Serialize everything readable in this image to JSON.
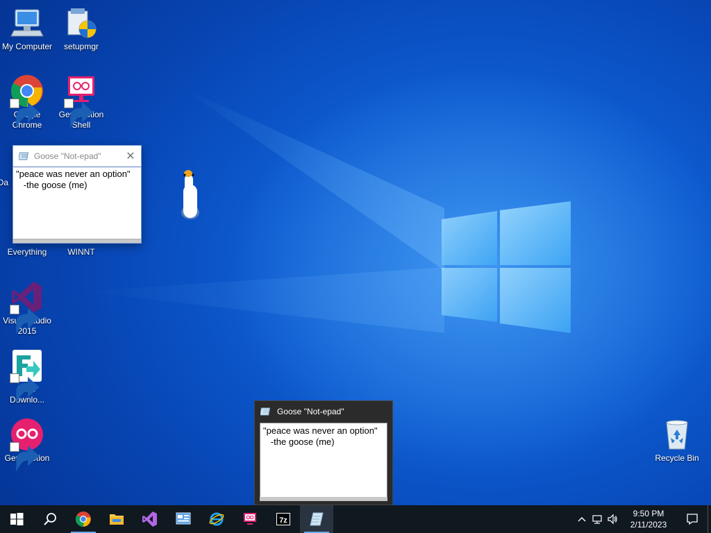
{
  "desktop": {
    "icons": [
      {
        "label": "My Computer",
        "icon": "computer-icon"
      },
      {
        "label": "setupmgr",
        "icon": "setup-package-icon"
      },
      {
        "label": "Google Chrome",
        "icon": "chrome-icon"
      },
      {
        "label": "Genymotion Shell",
        "icon": "genymotion-shell-icon"
      },
      {
        "label": "Da",
        "icon": "partial-hidden-icon"
      },
      {
        "label": "Everything",
        "icon": "everything-icon"
      },
      {
        "label": "WINNT",
        "icon": "folder-icon"
      },
      {
        "label": "Visual Studio 2015",
        "icon": "visual-studio-icon"
      },
      {
        "label": "Free Downlo...",
        "icon": "free-download-manager-icon"
      },
      {
        "label": "Genymotion",
        "icon": "genymotion-icon"
      },
      {
        "label": "Recycle Bin",
        "icon": "recycle-bin-icon"
      }
    ]
  },
  "notepad_window": {
    "title": "Goose \"Not-epad\"",
    "text": "\"peace was never an option\"\n   -the goose (me)"
  },
  "taskbar_preview": {
    "title": "Goose \"Not-epad\"",
    "text": "\"peace was never an option\"\n   -the goose (me)"
  },
  "taskbar": {
    "buttons": [
      {
        "name": "start",
        "icon": "windows-start-icon"
      },
      {
        "name": "search",
        "icon": "search-icon"
      },
      {
        "name": "chrome",
        "icon": "chrome-icon"
      },
      {
        "name": "file-explorer",
        "icon": "folder-icon"
      },
      {
        "name": "visual-studio",
        "icon": "visual-studio-icon"
      },
      {
        "name": "control-panel",
        "icon": "control-panel-icon"
      },
      {
        "name": "internet-explorer",
        "icon": "internet-explorer-icon"
      },
      {
        "name": "genymotion",
        "icon": "genymotion-icon"
      },
      {
        "name": "7zip",
        "icon": "7zip-icon",
        "label": "7z"
      },
      {
        "name": "goose-notepad",
        "icon": "notepad-icon"
      }
    ],
    "tray": {
      "time": "9:50 PM",
      "date": "2/11/2023"
    }
  },
  "colors": {
    "wallpaper": "#0d5cd0",
    "taskbar": "#101820",
    "chrome_red": "#db4437",
    "chrome_green": "#0f9d58",
    "chrome_yellow": "#f4b400",
    "chrome_blue": "#4285f4",
    "vs_purple": "#68217a",
    "genymotion_pink": "#e5206f"
  }
}
